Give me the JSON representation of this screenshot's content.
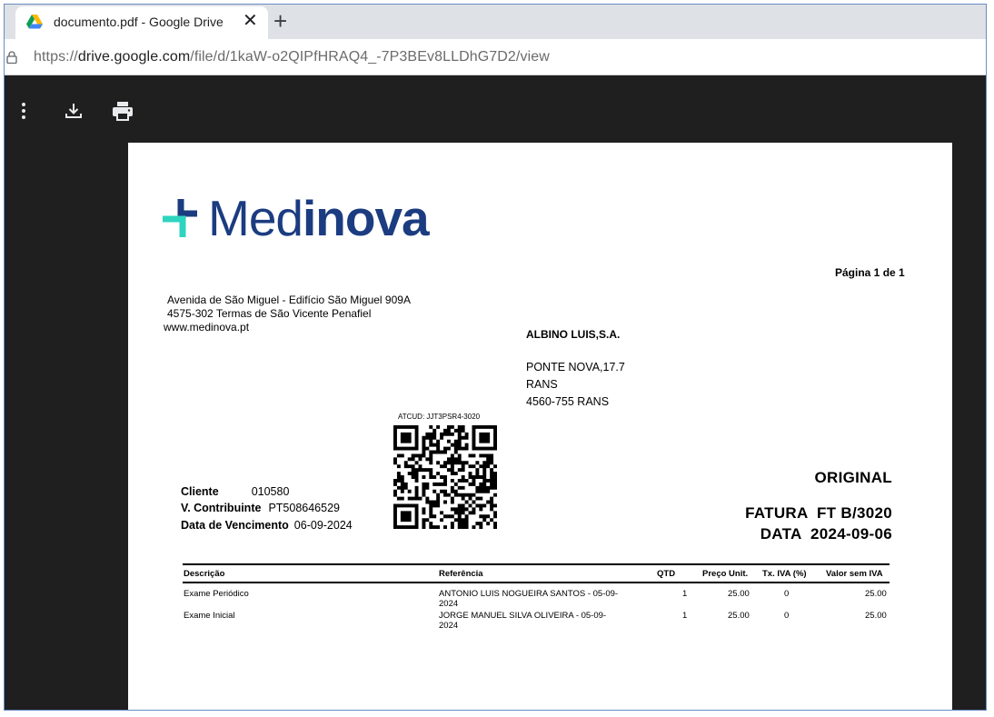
{
  "browser": {
    "tab_title": "documento.pdf - Google Drive",
    "tab_close": "✕",
    "new_tab": "+",
    "url_scheme": "https://",
    "url_host": "drive.google.com",
    "url_path": "/file/d/1kaW-o2QIPfHRAQ4_-7P3BEv8LLDhG7D2/view"
  },
  "viewer": {
    "icons": [
      "more-vert-icon",
      "download-icon",
      "print-icon"
    ]
  },
  "invoice": {
    "logo_light": "Med",
    "logo_bold": "inova",
    "page_number": "Página 1 de 1",
    "seller_address": [
      "Avenida de São Miguel - Edifício São Miguel 909A",
      "4575-302 Termas de São Vicente Penafiel",
      "www.medinova.pt"
    ],
    "buyer_name": "ALBINO LUIS,S.A.",
    "buyer_address": [
      "PONTE NOVA,17.7",
      "RANS",
      "4560-755 RANS"
    ],
    "atcud": "ATCUD: JJT3PSR4-3020",
    "client_label": "Cliente",
    "client_value": "010580",
    "vat_label": "V. Contribuinte",
    "vat_value": "PT508646529",
    "due_label": "Data de Vencimento",
    "due_value": "06-09-2024",
    "copy_label": "ORIGINAL",
    "doc_label": "FATURA  FT B/3020",
    "date_label": "DATA  2024-09-06",
    "table": {
      "headers": [
        "Descrição",
        "Referência",
        "QTD",
        "Preço Unit.",
        "Tx. IVA (%)",
        "Valor sem IVA"
      ],
      "rows": [
        {
          "desc": "Exame Periódico",
          "ref1": "ANTONIO LUIS NOGUEIRA SANTOS - 05-09-",
          "ref2": "2024",
          "qty": "1",
          "price": "25.00",
          "vat": "0",
          "total": "25.00"
        },
        {
          "desc": "Exame Inicial",
          "ref1": "JORGE MANUEL SILVA OLIVEIRA  - 05-09-",
          "ref2": "2024",
          "qty": "1",
          "price": "25.00",
          "vat": "0",
          "total": "25.00"
        }
      ]
    }
  },
  "colors": {
    "brand_navy": "#1b3c80",
    "brand_teal": "#2dd4bf",
    "viewer_bg": "#1f1f1f"
  }
}
